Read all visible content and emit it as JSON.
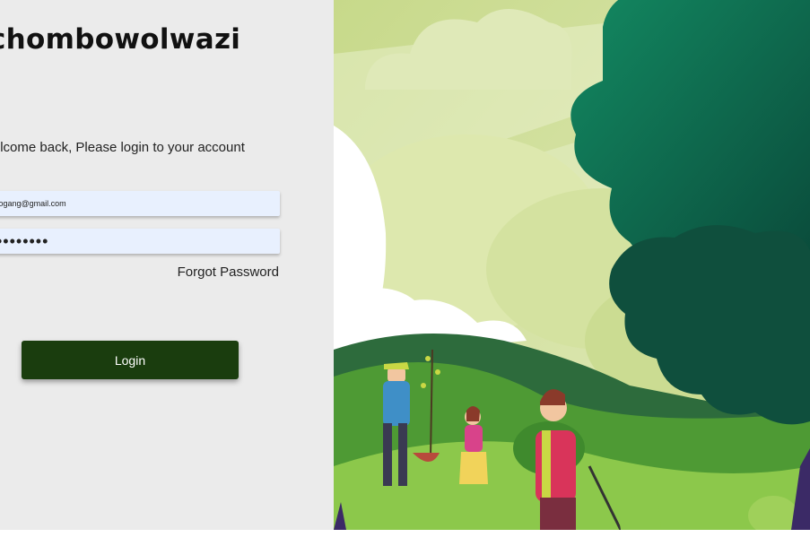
{
  "brand": {
    "name": "chombowolwazi"
  },
  "login": {
    "welcome_text": "Welcome back, Please login to your account",
    "email_value": "fogang@gmail.com",
    "password_value": "••••••••",
    "forgot_label": "Forgot Password",
    "login_label": "Login"
  },
  "colors": {
    "panel_bg": "#ebebeb",
    "button_bg": "#1a3d0e",
    "input_bg": "#e8f0fe",
    "tree_dark": "#0e5c45",
    "hill_green": "#6fb23f"
  },
  "illustration": {
    "icon": "tree-planting-illustration"
  }
}
